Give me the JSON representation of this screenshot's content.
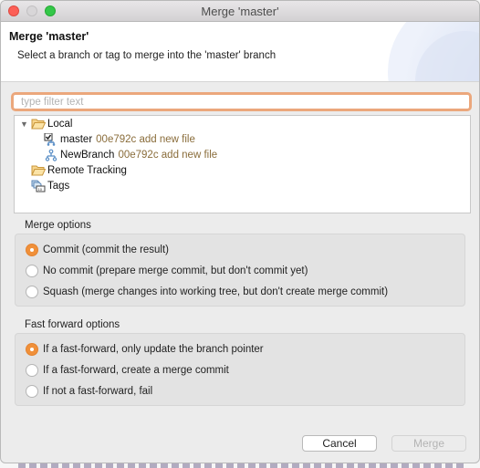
{
  "window": {
    "title": "Merge 'master'",
    "controls": [
      "close",
      "minimize",
      "maximize"
    ]
  },
  "header": {
    "title": "Merge 'master'",
    "description": "Select a branch or tag to merge into the 'master' branch"
  },
  "filter": {
    "value": "",
    "placeholder": "type filter text"
  },
  "tree": {
    "items": [
      {
        "label": "Local",
        "icon": "folder-open-icon",
        "expanded": true,
        "level": 0
      },
      {
        "label": "master",
        "commit": "00e792c add new file",
        "icon": "branch-checked-out-icon",
        "level": 1
      },
      {
        "label": "NewBranch",
        "commit": "00e792c add new file",
        "icon": "branch-icon",
        "level": 1
      },
      {
        "label": "Remote Tracking",
        "icon": "folder-open-icon",
        "level": 0
      },
      {
        "label": "Tags",
        "icon": "tags-icon",
        "level": 0
      }
    ]
  },
  "merge_options": {
    "label": "Merge options",
    "selected": 0,
    "options": [
      "Commit (commit the result)",
      "No commit (prepare merge commit, but don't commit yet)",
      "Squash (merge changes into working tree, but don't create merge commit)"
    ]
  },
  "fast_forward_options": {
    "label": "Fast forward options",
    "selected": 0,
    "options": [
      "If a fast-forward, only update the branch pointer",
      "If a fast-forward, create a merge commit",
      "If not a fast-forward, fail"
    ]
  },
  "buttons": {
    "cancel": "Cancel",
    "merge": "Merge",
    "merge_enabled": false
  },
  "colors": {
    "accent": "#f0903a",
    "focus_ring": "#eba77c",
    "commit_text": "#8a6d3b"
  }
}
